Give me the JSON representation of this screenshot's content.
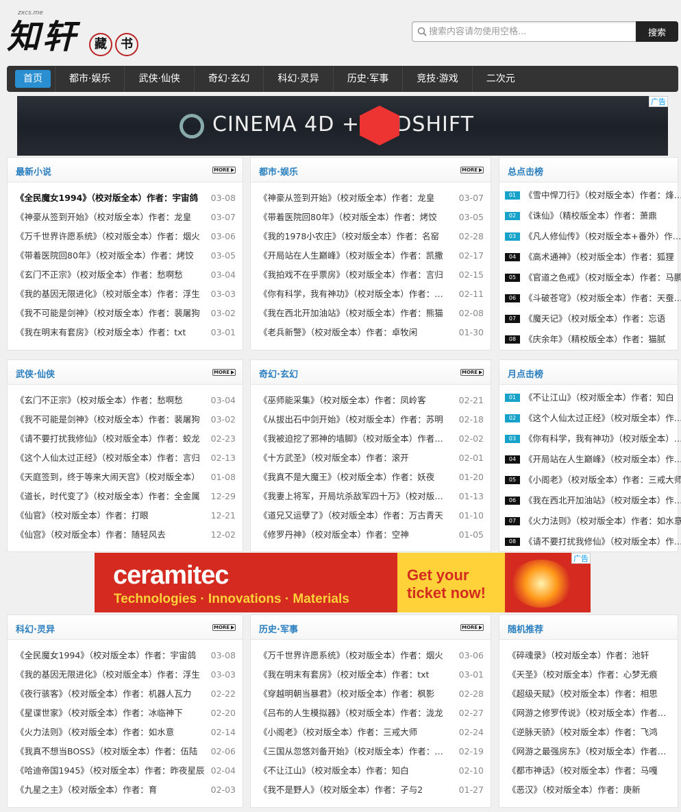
{
  "logo": {
    "main": "知轩",
    "sub": "zxcs.me",
    "seal1": "藏",
    "seal2": "书"
  },
  "search": {
    "placeholder": "搜索内容请勿使用空格...",
    "button": "搜索"
  },
  "nav": [
    {
      "label": "首页",
      "active": true
    },
    {
      "label": "都市·娱乐"
    },
    {
      "label": "武侠·仙侠"
    },
    {
      "label": "奇幻·玄幻"
    },
    {
      "label": "科幻·灵异"
    },
    {
      "label": "历史·军事"
    },
    {
      "label": "竞技·游戏"
    },
    {
      "label": "二次元"
    }
  ],
  "ad_top": {
    "text": "CINEMA 4D  +  REDSHIFT",
    "tag": "广告"
  },
  "ad_mid": {
    "logo": "ceramitec",
    "sub": "Technologies · Innovations · Materials",
    "cta": "Get your ticket now!",
    "tag": "广告"
  },
  "more_label": "MORE",
  "panels": {
    "latest": {
      "title": "最新小说",
      "items": [
        {
          "t": "《全民魔女1994》（校对版全本）作者：宇宙鸽",
          "d": "03-08",
          "b": true
        },
        {
          "t": "《神豪从签到开始》（校对版全本）作者：龙皇",
          "d": "03-07"
        },
        {
          "t": "《万千世界许愿系统》（校对版全本）作者：烟火",
          "d": "03-06"
        },
        {
          "t": "《带着医院回80年》（校对版全本）作者：烤饺",
          "d": "03-05"
        },
        {
          "t": "《玄门不正宗》（校对版全本）作者：愁啊愁",
          "d": "03-04"
        },
        {
          "t": "《我的基因无限进化》（校对版全本）作者：浮生",
          "d": "03-03"
        },
        {
          "t": "《我不可能是剑神》（校对版全本）作者：裴屠狗",
          "d": "03-02"
        },
        {
          "t": "《我在明末有套房》（校对版全本）作者：txt",
          "d": "03-01"
        }
      ]
    },
    "dushi": {
      "title": "都市·娱乐",
      "items": [
        {
          "t": "《神豪从签到开始》（校对版全本）作者：龙皇",
          "d": "03-07"
        },
        {
          "t": "《带着医院回80年》（校对版全本）作者：烤饺",
          "d": "03-05"
        },
        {
          "t": "《我的1978小农庄》（校对版全本）作者：名窑",
          "d": "02-28"
        },
        {
          "t": "《开局站在人生巅峰》（校对版全本）作者：凯撒",
          "d": "02-17"
        },
        {
          "t": "《我拍戏不在乎票房》（校对版全本）作者：言归",
          "d": "02-15"
        },
        {
          "t": "《你有科学，我有神功》（校对版全本）作者：三万",
          "d": "02-11"
        },
        {
          "t": "《我在西北开加油站》（校对版全本）作者：熊猫",
          "d": "02-08"
        },
        {
          "t": "《老兵新警》（校对版全本）作者：卓牧闲",
          "d": "01-30"
        }
      ]
    },
    "hot": {
      "title": "总点击榜",
      "items": [
        "《雪中悍刀行》（校对版全本）作者：烽火戏诸侯",
        "《诛仙》（精校版全本）作者：萧鼎",
        "《凡人修仙传》（校对版全本+番外）作者：忘语",
        "《高术通神》（校对版全本）作者：狐狸",
        "《官道之色戒》（校对版全本）作者：马鹏",
        "《斗破苍穹》（校对版全本）作者：天蚕土豆",
        "《魔天记》（校对版全本）作者：忘语",
        "《庆余年》（精校版全本）作者：猫腻"
      ]
    },
    "wuxia": {
      "title": "武侠·仙侠",
      "items": [
        {
          "t": "《玄门不正宗》（校对版全本）作者：愁啊愁",
          "d": "03-04"
        },
        {
          "t": "《我不可能是剑神》（校对版全本）作者：裴屠狗",
          "d": "03-02"
        },
        {
          "t": "《请不要打扰我修仙》（校对版全本）作者：蛟龙",
          "d": "02-23"
        },
        {
          "t": "《这个人仙太过正经》（校对版全本）作者：言归",
          "d": "02-13"
        },
        {
          "t": "《天庭签到，终于等来大闹天宫》（校对版全本）",
          "d": "01-08"
        },
        {
          "t": "《道长，时代变了》（校对版全本）作者：全金属",
          "d": "12-29"
        },
        {
          "t": "《仙官》（校对版全本）作者：打眼",
          "d": "12-21"
        },
        {
          "t": "《仙宫》（校对版全本）作者：随轻风去",
          "d": "12-02"
        }
      ]
    },
    "qihuan": {
      "title": "奇幻·玄幻",
      "items": [
        {
          "t": "《巫师能采集》（校对版全本）作者：凤岭客",
          "d": "02-21"
        },
        {
          "t": "《从拔出石中剑开始》（校对版全本）作者：苏明",
          "d": "02-18"
        },
        {
          "t": "《我被迫挖了邪神的墙脚》（校对版全本）作者：某某",
          "d": "02-02"
        },
        {
          "t": "《十方武圣》（校对版全本）作者：滚开",
          "d": "02-01"
        },
        {
          "t": "《我真不是大魔王》（校对版全本）作者：妖夜",
          "d": "01-20"
        },
        {
          "t": "《我妻上将军，开局坑杀敌军四十万》（校对版全本）",
          "d": "01-13"
        },
        {
          "t": "《道兄又运孽了》（校对版全本）作者：万古青天",
          "d": "01-10"
        },
        {
          "t": "《修罗丹神》（校对版全本）作者：空神",
          "d": "01-05"
        }
      ]
    },
    "month": {
      "title": "月点击榜",
      "items": [
        "《不让江山》（校对版全本）作者：知白",
        "《这个人仙太过正经》（校对版全本）作者：言归",
        "《你有科学，我有神功》（校对版全本）作者：三万",
        "《开局站在人生巅峰》（校对版全本）作者：凯撒",
        "《小阁老》（校对版全本）作者：三戒大师",
        "《我在西北开加油站》（校对版全本）作者：熊猫",
        "《火力法则》（校对版全本）作者：如水意",
        "《请不要打扰我修仙》（校对版全本）作者：蛟龙"
      ]
    },
    "kehuan": {
      "title": "科幻·灵异",
      "items": [
        {
          "t": "《全民魔女1994》（校对版全本）作者：宇宙鸽",
          "d": "03-08"
        },
        {
          "t": "《我的基因无限进化》（校对版全本）作者：浮生",
          "d": "03-03"
        },
        {
          "t": "《夜行骇客》（校对版全本）作者：机器人瓦力",
          "d": "02-22"
        },
        {
          "t": "《星谍世家》（校对版全本）作者：冰临神下",
          "d": "02-20"
        },
        {
          "t": "《火力法则》（校对版全本）作者：如水意",
          "d": "02-14"
        },
        {
          "t": "《我真不想当BOSS》（校对版全本）作者：伍陆",
          "d": "02-06"
        },
        {
          "t": "《哈迪帝国1945》（校对版全本）作者：昨夜星辰",
          "d": "02-04"
        },
        {
          "t": "《九星之主》（校对版全本）作者：育",
          "d": "02-03"
        }
      ]
    },
    "lishi": {
      "title": "历史·军事",
      "items": [
        {
          "t": "《万千世界许愿系统》（校对版全本）作者：烟火",
          "d": "03-06"
        },
        {
          "t": "《我在明末有套房》（校对版全本）作者：txt",
          "d": "03-01"
        },
        {
          "t": "《穿越明朝当暴君》（校对版全本）作者：枫影",
          "d": "02-28"
        },
        {
          "t": "《吕布的人生模拟器》（校对版全本）作者：泷龙",
          "d": "02-27"
        },
        {
          "t": "《小阁老》（校对版全本）作者：三戒大师",
          "d": "02-24"
        },
        {
          "t": "《三国从忽悠刘备开始》（校对版全本）作者：钓鱼",
          "d": "02-19"
        },
        {
          "t": "《不让江山》（校对版全本）作者：知白",
          "d": "02-10"
        },
        {
          "t": "《我不是野人》（校对版全本）作者：孑与2",
          "d": "01-27"
        }
      ]
    },
    "random": {
      "title": "随机推荐",
      "items": [
        "《碎魂录》（校对版全本）作者：池轩",
        "《天圣》（校对版全本）作者：心梦无痕",
        "《超级天赋》（校对版全本）作者：相思",
        "《网游之修罗传说》（校对版全本）作者：七月",
        "《逆脉天骄》（校对版全本）作者：飞鸿",
        "《网游之最强房东》（校对版全本）作者：乐林",
        "《都市神话》（校对版全本）作者：马嘎",
        "《恶汉》（校对版全本）作者：庚新"
      ]
    }
  },
  "ranks": [
    "01",
    "02",
    "03",
    "04",
    "05",
    "06",
    "07",
    "08"
  ]
}
